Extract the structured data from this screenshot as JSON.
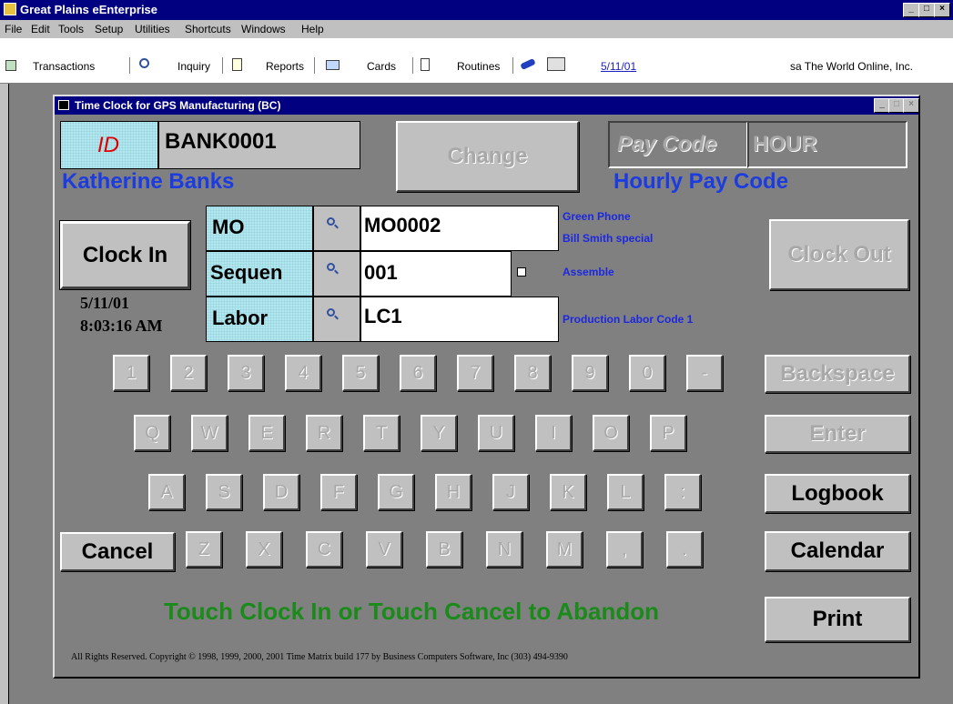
{
  "app": {
    "title": "Great Plains eEnterprise",
    "controls": [
      "_",
      "□",
      "×"
    ]
  },
  "menu": [
    "File",
    "Edit",
    "Tools",
    "Setup",
    "Utilities",
    "Shortcuts",
    "Windows",
    "Help"
  ],
  "toolbar": {
    "transactions": "Transactions",
    "inquiry": "Inquiry",
    "reports": "Reports",
    "cards": "Cards",
    "routines": "Routines",
    "date": "5/11/01",
    "user_company": "sa  The World Online, Inc."
  },
  "window": {
    "title": "Time Clock for GPS Manufacturing (BC)"
  },
  "employee": {
    "id_label": "ID",
    "id_value": "BANK0001",
    "name": "Katherine Banks"
  },
  "change_button": "Change",
  "pay_code": {
    "label": "Pay Code",
    "value": "HOUR",
    "description": "Hourly Pay Code"
  },
  "clock_in_button": "Clock In",
  "clock_out_button": "Clock Out",
  "timestamp": {
    "date": "5/11/01",
    "time": "8:03:16 AM"
  },
  "fields": {
    "mo_label": "MO",
    "mo_value": "MO0002",
    "mo_desc1": "Green Phone",
    "mo_desc2": "Bill Smith special",
    "seq_label": "Sequen",
    "seq_value": "001",
    "seq_desc": "Assemble",
    "labor_label": "Labor",
    "labor_value": "LC1",
    "labor_desc": "Production Labor Code 1"
  },
  "keypad": {
    "row1": [
      "1",
      "2",
      "3",
      "4",
      "5",
      "6",
      "7",
      "8",
      "9",
      "0",
      "-"
    ],
    "row2": [
      "Q",
      "W",
      "E",
      "R",
      "T",
      "Y",
      "U",
      "I",
      "O",
      "P"
    ],
    "row3": [
      "A",
      "S",
      "D",
      "F",
      "G",
      "H",
      "J",
      "K",
      "L",
      ":"
    ],
    "row4": [
      "Z",
      "X",
      "C",
      "V",
      "B",
      "N",
      "M",
      ",",
      "."
    ]
  },
  "side_buttons": {
    "backspace": "Backspace",
    "enter": "Enter",
    "logbook": "Logbook",
    "calendar": "Calendar",
    "print": "Print",
    "cancel": "Cancel"
  },
  "instruction": "Touch Clock In or Touch Cancel to Abandon",
  "copyright": "All Rights Reserved. Copyright © 1998, 1999, 2000, 2001   Time Matrix build 177  by Business Computers Software, Inc  (303) 494-9390",
  "colors": {
    "titlebar": "#000080",
    "instruction_green": "#1a8a1a",
    "label_blue": "#1c3ce0",
    "id_red": "#e00000"
  }
}
